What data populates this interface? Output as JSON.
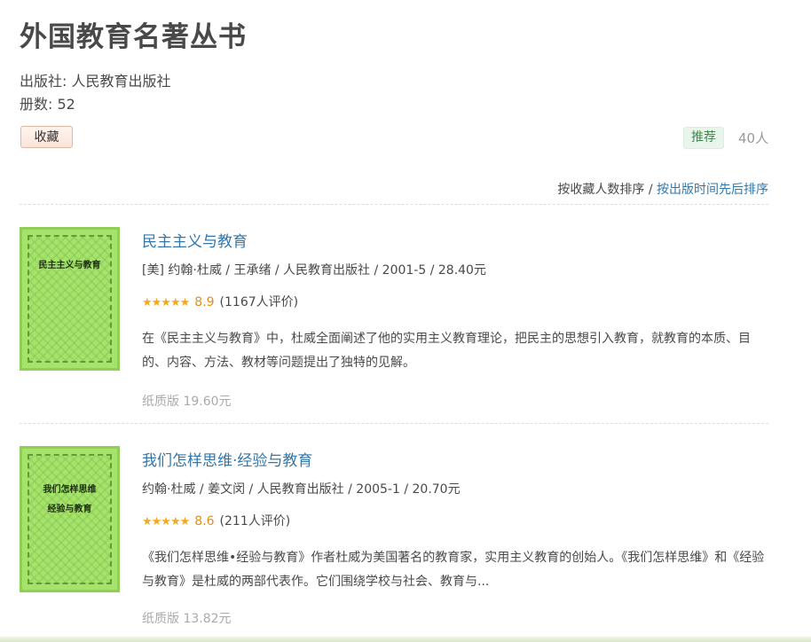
{
  "page": {
    "title": "外国教育名著丛书",
    "publisher": "出版社: 人民教育出版社",
    "count": "册数:  52",
    "collect_label": "收藏",
    "recommend_label": "推荐",
    "recommend_count": "40人",
    "sort_by_collect": "按收藏人数排序",
    "sort_sep": " / ",
    "sort_by_date": "按出版时间先后排序"
  },
  "books": [
    {
      "title": "民主主义与教育",
      "pub": "[美] 约翰·杜威 / 王承绪 / 人民教育出版社 / 2001-5 / 28.40元",
      "stars": "★★★★★",
      "score": "8.9",
      "votes": "(1167人评价)",
      "intro": "在《民主主义与教育》中，杜威全面阐述了他的实用主义教育理论，把民主的思想引入教育，就教育的本质、目的、内容、方法、教材等问题提出了独特的见解。",
      "price": "纸质版 19.60元",
      "cover_title": "民主主义与教育"
    },
    {
      "title": "我们怎样思维·经验与教育",
      "pub": "约翰·杜威 / 姜文闵 / 人民教育出版社 / 2005-1 / 20.70元",
      "stars": "★★★★★",
      "score": "8.6",
      "votes": "(211人评价)",
      "intro": "《我们怎样思维•经验与教育》作者杜威为美国著名的教育家，实用主义教育的创始人。《我们怎样思维》和《经验与教育》是杜威的两部代表作。它们围绕学校与社会、教育与...",
      "price": "纸质版 13.82元",
      "cover_title_1": "我们怎样思维",
      "cover_title_2": "经验与教育"
    }
  ],
  "colors": {
    "link": "#3377aa",
    "star": "#f4a91d",
    "cover_green": "#a5e36b"
  }
}
